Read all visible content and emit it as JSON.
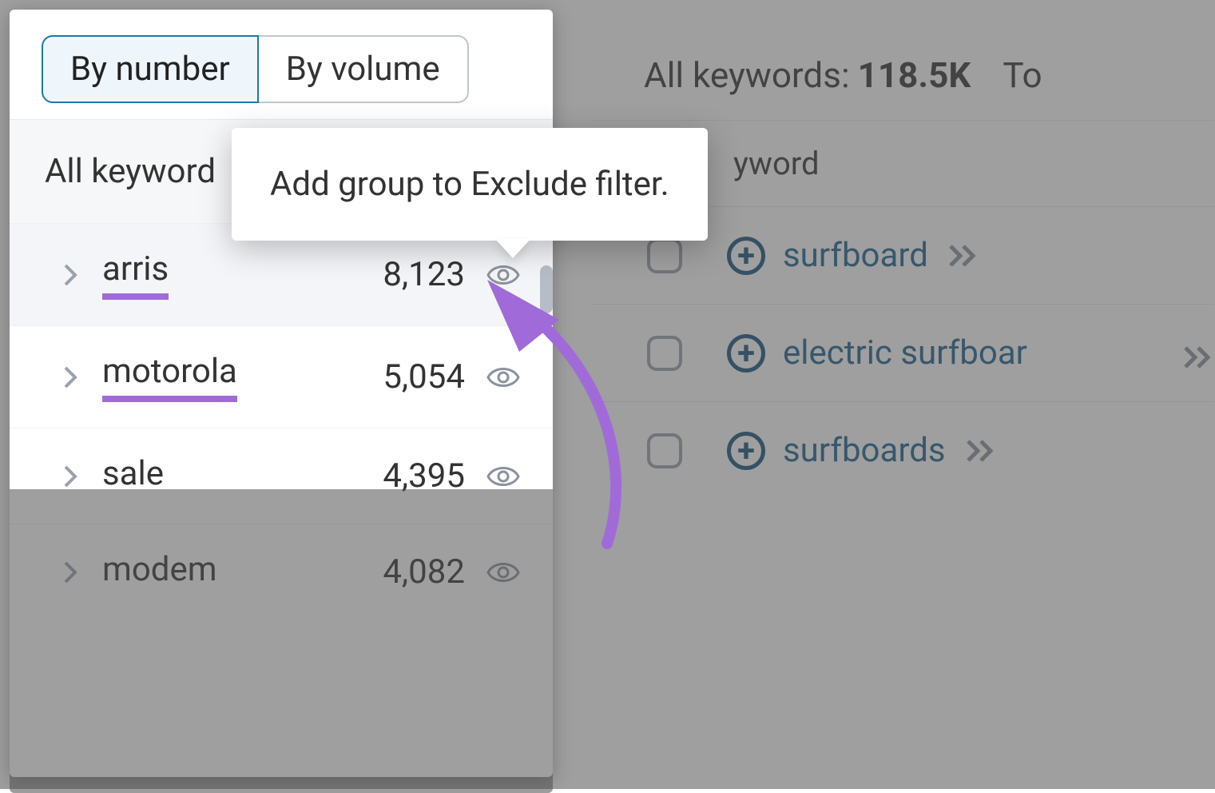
{
  "tabs": {
    "by_number": "By number",
    "by_volume": "By volume"
  },
  "sidebar": {
    "all_keywords_label": "All keyword",
    "groups": [
      {
        "name": "arris",
        "count": "8,123",
        "underlined": true,
        "hovered": true
      },
      {
        "name": "motorola",
        "count": "5,054",
        "underlined": true,
        "hovered": false
      },
      {
        "name": "sale",
        "count": "4,395",
        "underlined": false,
        "hovered": false
      },
      {
        "name": "modem",
        "count": "4,082",
        "underlined": false,
        "hovered": false
      }
    ]
  },
  "tooltip": {
    "text": "Add group to Exclude filter."
  },
  "results": {
    "header_label": "All keywords:",
    "header_value": "118.5K",
    "header_trail": "To",
    "column_label": "yword",
    "rows": [
      {
        "keyword": "surfboard"
      },
      {
        "keyword": "electric surfboar"
      },
      {
        "keyword": "surfboards"
      }
    ]
  }
}
